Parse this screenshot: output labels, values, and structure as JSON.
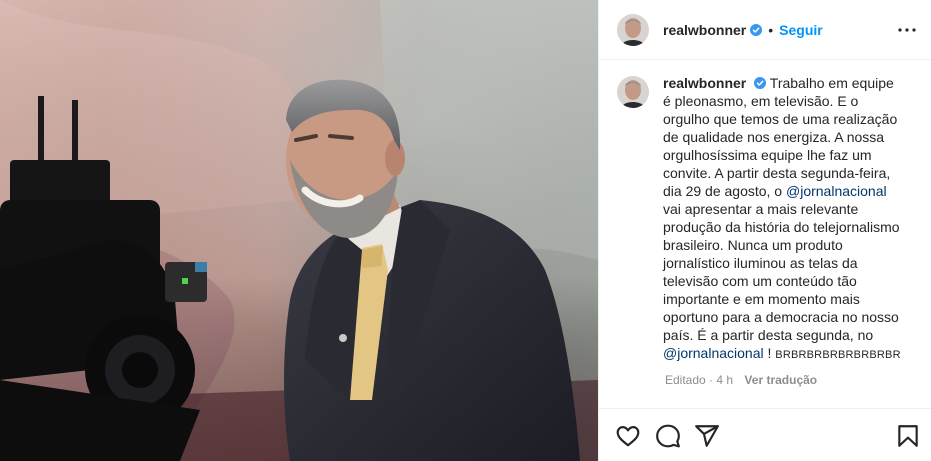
{
  "post": {
    "username": "realwbonner",
    "follow_label": "Seguir",
    "separator": "•",
    "caption": {
      "username": "realwbonner",
      "text_1": "Trabalho em equipe é pleonasmo, em televisão. E o orgulho que temos de uma realização de qualidade nos energiza. A nossa orgulhosíssima equipe lhe faz um convite. A partir desta segunda-feira, dia 29 de agosto, o ",
      "mention_1": "@jornalnacional",
      "text_2": " vai apresentar a mais relevante produção da história do telejornalismo brasileiro. Nunca um produto jornalístico iluminou as telas da televisão com um conteúdo tão importante e em momento mais oportuno para a democracia no nosso país. É a partir desta segunda, no ",
      "mention_2": "@jornalnacional",
      "text_3": " ! ",
      "tail": "BRBRBRBRBRBRBRBR"
    },
    "meta": {
      "edited": "Editado",
      "dot": "·",
      "time": "4 h",
      "translate": "Ver tradução"
    }
  },
  "icons": {
    "verified": "verified-badge-icon",
    "more": "more-options-icon",
    "like": "heart-icon",
    "comment": "comment-icon",
    "share": "share-icon",
    "save": "bookmark-icon"
  },
  "colors": {
    "link": "#0095f6",
    "mention": "#00376b",
    "muted": "#8e8e8e",
    "text": "#262626"
  }
}
